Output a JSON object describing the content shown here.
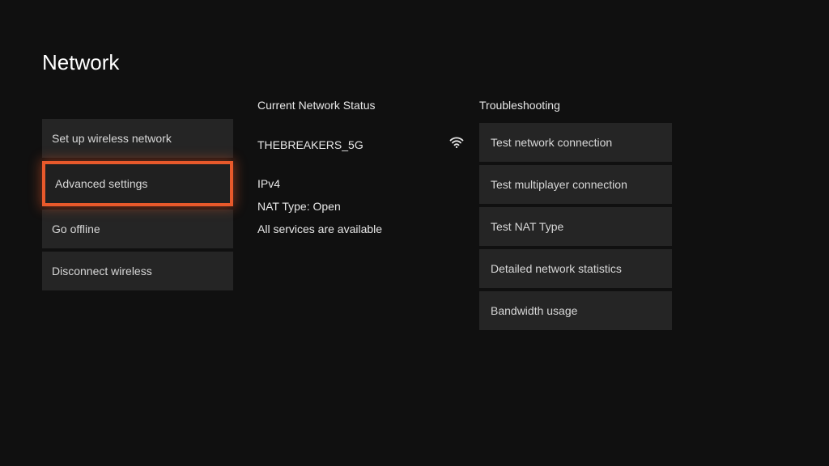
{
  "title": "Network",
  "sidebar": {
    "items": [
      {
        "label": "Set up wireless network",
        "selected": false
      },
      {
        "label": "Advanced settings",
        "selected": true
      },
      {
        "label": "Go offline",
        "selected": false
      },
      {
        "label": "Disconnect wireless",
        "selected": false
      }
    ]
  },
  "status": {
    "heading": "Current Network Status",
    "network_name": "THEBREAKERS_5G",
    "icon": "wifi-icon",
    "lines": [
      "IPv4",
      "NAT Type: Open",
      "All services are available"
    ]
  },
  "troubleshooting": {
    "heading": "Troubleshooting",
    "items": [
      {
        "label": "Test network connection"
      },
      {
        "label": "Test multiplayer connection"
      },
      {
        "label": "Test NAT Type"
      },
      {
        "label": "Detailed network statistics"
      },
      {
        "label": "Bandwidth usage"
      }
    ]
  }
}
